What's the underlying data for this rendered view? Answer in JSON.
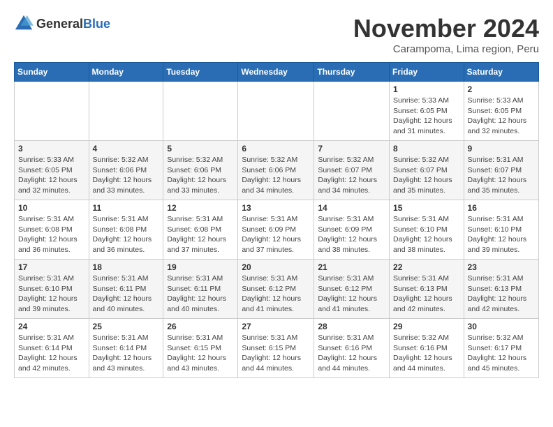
{
  "logo": {
    "general": "General",
    "blue": "Blue"
  },
  "title": "November 2024",
  "location": "Carampoma, Lima region, Peru",
  "weekdays": [
    "Sunday",
    "Monday",
    "Tuesday",
    "Wednesday",
    "Thursday",
    "Friday",
    "Saturday"
  ],
  "weeks": [
    [
      {
        "day": "",
        "info": ""
      },
      {
        "day": "",
        "info": ""
      },
      {
        "day": "",
        "info": ""
      },
      {
        "day": "",
        "info": ""
      },
      {
        "day": "",
        "info": ""
      },
      {
        "day": "1",
        "info": "Sunrise: 5:33 AM\nSunset: 6:05 PM\nDaylight: 12 hours and 31 minutes."
      },
      {
        "day": "2",
        "info": "Sunrise: 5:33 AM\nSunset: 6:05 PM\nDaylight: 12 hours and 32 minutes."
      }
    ],
    [
      {
        "day": "3",
        "info": "Sunrise: 5:33 AM\nSunset: 6:05 PM\nDaylight: 12 hours and 32 minutes."
      },
      {
        "day": "4",
        "info": "Sunrise: 5:32 AM\nSunset: 6:06 PM\nDaylight: 12 hours and 33 minutes."
      },
      {
        "day": "5",
        "info": "Sunrise: 5:32 AM\nSunset: 6:06 PM\nDaylight: 12 hours and 33 minutes."
      },
      {
        "day": "6",
        "info": "Sunrise: 5:32 AM\nSunset: 6:06 PM\nDaylight: 12 hours and 34 minutes."
      },
      {
        "day": "7",
        "info": "Sunrise: 5:32 AM\nSunset: 6:07 PM\nDaylight: 12 hours and 34 minutes."
      },
      {
        "day": "8",
        "info": "Sunrise: 5:32 AM\nSunset: 6:07 PM\nDaylight: 12 hours and 35 minutes."
      },
      {
        "day": "9",
        "info": "Sunrise: 5:31 AM\nSunset: 6:07 PM\nDaylight: 12 hours and 35 minutes."
      }
    ],
    [
      {
        "day": "10",
        "info": "Sunrise: 5:31 AM\nSunset: 6:08 PM\nDaylight: 12 hours and 36 minutes."
      },
      {
        "day": "11",
        "info": "Sunrise: 5:31 AM\nSunset: 6:08 PM\nDaylight: 12 hours and 36 minutes."
      },
      {
        "day": "12",
        "info": "Sunrise: 5:31 AM\nSunset: 6:08 PM\nDaylight: 12 hours and 37 minutes."
      },
      {
        "day": "13",
        "info": "Sunrise: 5:31 AM\nSunset: 6:09 PM\nDaylight: 12 hours and 37 minutes."
      },
      {
        "day": "14",
        "info": "Sunrise: 5:31 AM\nSunset: 6:09 PM\nDaylight: 12 hours and 38 minutes."
      },
      {
        "day": "15",
        "info": "Sunrise: 5:31 AM\nSunset: 6:10 PM\nDaylight: 12 hours and 38 minutes."
      },
      {
        "day": "16",
        "info": "Sunrise: 5:31 AM\nSunset: 6:10 PM\nDaylight: 12 hours and 39 minutes."
      }
    ],
    [
      {
        "day": "17",
        "info": "Sunrise: 5:31 AM\nSunset: 6:10 PM\nDaylight: 12 hours and 39 minutes."
      },
      {
        "day": "18",
        "info": "Sunrise: 5:31 AM\nSunset: 6:11 PM\nDaylight: 12 hours and 40 minutes."
      },
      {
        "day": "19",
        "info": "Sunrise: 5:31 AM\nSunset: 6:11 PM\nDaylight: 12 hours and 40 minutes."
      },
      {
        "day": "20",
        "info": "Sunrise: 5:31 AM\nSunset: 6:12 PM\nDaylight: 12 hours and 41 minutes."
      },
      {
        "day": "21",
        "info": "Sunrise: 5:31 AM\nSunset: 6:12 PM\nDaylight: 12 hours and 41 minutes."
      },
      {
        "day": "22",
        "info": "Sunrise: 5:31 AM\nSunset: 6:13 PM\nDaylight: 12 hours and 42 minutes."
      },
      {
        "day": "23",
        "info": "Sunrise: 5:31 AM\nSunset: 6:13 PM\nDaylight: 12 hours and 42 minutes."
      }
    ],
    [
      {
        "day": "24",
        "info": "Sunrise: 5:31 AM\nSunset: 6:14 PM\nDaylight: 12 hours and 42 minutes."
      },
      {
        "day": "25",
        "info": "Sunrise: 5:31 AM\nSunset: 6:14 PM\nDaylight: 12 hours and 43 minutes."
      },
      {
        "day": "26",
        "info": "Sunrise: 5:31 AM\nSunset: 6:15 PM\nDaylight: 12 hours and 43 minutes."
      },
      {
        "day": "27",
        "info": "Sunrise: 5:31 AM\nSunset: 6:15 PM\nDaylight: 12 hours and 44 minutes."
      },
      {
        "day": "28",
        "info": "Sunrise: 5:31 AM\nSunset: 6:16 PM\nDaylight: 12 hours and 44 minutes."
      },
      {
        "day": "29",
        "info": "Sunrise: 5:32 AM\nSunset: 6:16 PM\nDaylight: 12 hours and 44 minutes."
      },
      {
        "day": "30",
        "info": "Sunrise: 5:32 AM\nSunset: 6:17 PM\nDaylight: 12 hours and 45 minutes."
      }
    ]
  ]
}
